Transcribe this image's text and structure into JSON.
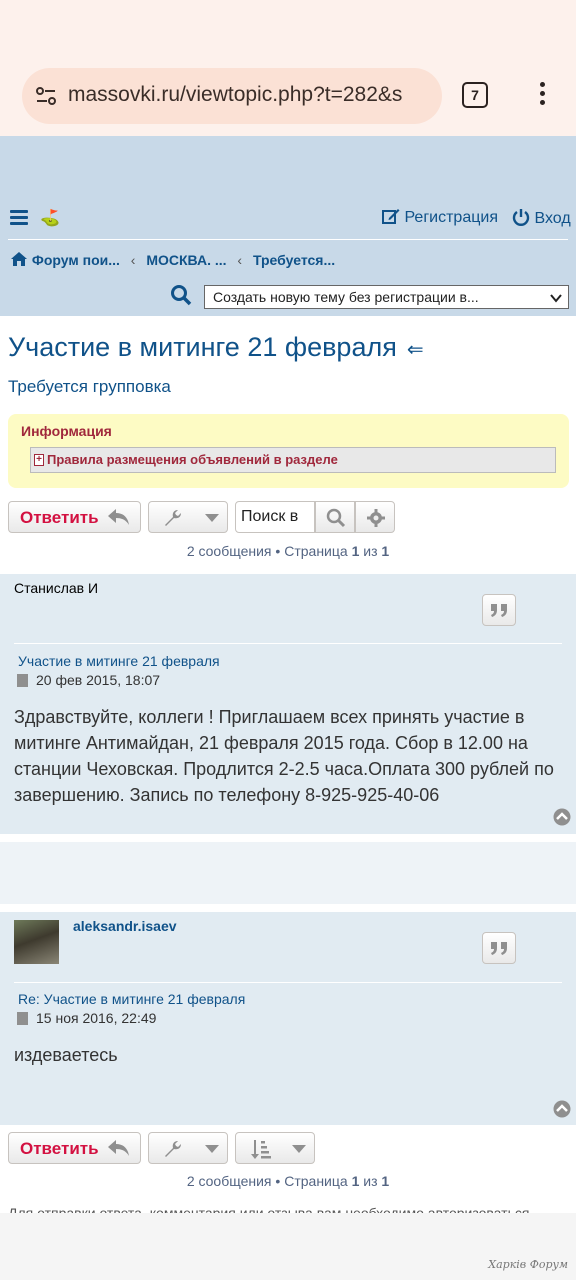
{
  "browser": {
    "url": "massovki.ru/viewtopic.php?t=282&s",
    "tab_count": "7"
  },
  "nav": {
    "register": "Регистрация",
    "login": "Вход",
    "breadcrumbs": [
      "Форум пои...",
      "МОСКВА. ...",
      "Требуется..."
    ],
    "select_value": "Создать новую тему без регистрации в..."
  },
  "topic": {
    "title": "Участие в митинге 21 февраля",
    "back_arrow": "⇐",
    "forum": "Требуется групповка"
  },
  "info": {
    "heading": "Информация",
    "rule": "Правила размещения объявлений в разделе",
    "plus": "+"
  },
  "toolbar": {
    "reply": "Ответить",
    "search_placeholder": "Поиск в"
  },
  "pagination": {
    "count": "2 сообщения",
    "sep": " • ",
    "page_word": "Страница",
    "page": "1",
    "of": "из",
    "total": "1"
  },
  "posts": [
    {
      "author": "Станислав И",
      "title": "Участие в митинге 21 февраля",
      "date": "20 фев 2015, 18:07",
      "content": "Здравствуйте, коллеги ! Приглашаем всех принять участие в митинге Антимайдан, 21 февраля 2015 года. Сбор в 12.00 на станции Чеховская. Продлится 2-2.5 часа.Оплата 300 рублей по завершению. Запись по телефону 8-925-925-40-06"
    },
    {
      "author": "aleksandr.isaev",
      "title": "Re: Участие в митинге 21 февраля",
      "date": "15 ноя 2016, 22:49",
      "content": "издеваетесь"
    }
  ],
  "footer": {
    "notice": "Для отправки ответа, комментария или отзыва вам необходимо авторизоваться",
    "watermark": "Харків Форум"
  },
  "colors": {
    "link": "#105289",
    "reply": "#d31141",
    "post_bg": "#e1ebf2",
    "header_bg": "#c8d9e8"
  }
}
